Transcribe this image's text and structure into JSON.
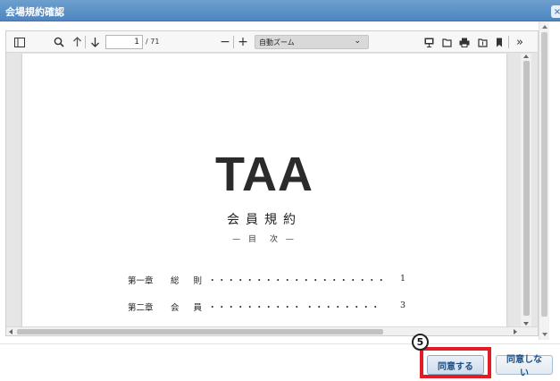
{
  "dialog": {
    "title": "会場規約確認",
    "close_glyph": "×"
  },
  "toolbar": {
    "page_current": "1",
    "page_total": "/ 71",
    "zoom_minus": "−",
    "zoom_plus": "+",
    "zoom_value": "自動ズーム",
    "zoom_caret": "⌄",
    "more_glyph": "»",
    "icons": [
      "sidebar-toggle-icon",
      "search-icon",
      "arrow-up-icon",
      "arrow-down-icon",
      "presentation-icon",
      "open-file-icon",
      "print-icon",
      "download-icon",
      "bookmark-icon",
      "more-tools-icon"
    ]
  },
  "document": {
    "logo": "TAA",
    "subtitle": "会員規約",
    "toc_heading": "— 目　次 —",
    "toc": [
      {
        "chapter": "第一章",
        "name": "総則",
        "dots": "・・・・・・・・・・・・・・・・・・・",
        "page": "1"
      },
      {
        "chapter": "第二章",
        "name": "会員",
        "dots": "・・・・・・・・・・ ・・・・・・・・",
        "page": "3"
      }
    ]
  },
  "footer": {
    "step_number": "5",
    "agree_label": "同意する",
    "disagree_label": "同意しない"
  },
  "colors": {
    "titlebar": "#5b8fc6",
    "highlight": "#e21c24",
    "button_text": "#1f4f87"
  }
}
